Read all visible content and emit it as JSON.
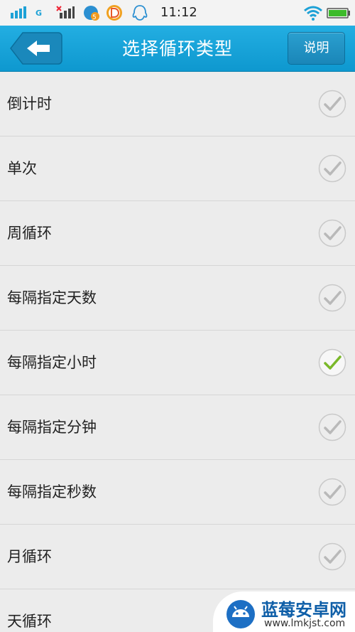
{
  "status_bar": {
    "time": "11:12",
    "network_label": "G",
    "notification_badge": "5",
    "icons": [
      "signal-icon",
      "network-g-icon",
      "signal-x-icon",
      "app-badge-icon",
      "d-app-icon",
      "qq-icon",
      "wifi-icon",
      "battery-icon"
    ]
  },
  "header": {
    "back_icon": "back-arrow-icon",
    "title": "选择循环类型",
    "help_label": "说明"
  },
  "options": [
    {
      "label": "倒计时",
      "selected": false
    },
    {
      "label": "单次",
      "selected": false
    },
    {
      "label": "周循环",
      "selected": false
    },
    {
      "label": "每隔指定天数",
      "selected": false
    },
    {
      "label": "每隔指定小时",
      "selected": true
    },
    {
      "label": "每隔指定分钟",
      "selected": false
    },
    {
      "label": "每隔指定秒数",
      "selected": false
    },
    {
      "label": "月循环",
      "selected": false
    },
    {
      "label": "天循环",
      "selected": false
    }
  ],
  "watermark": {
    "name": "蓝莓安卓网",
    "url": "www.lmkjst.com"
  },
  "colors": {
    "header": "#169fd6",
    "selected_check": "#7ab829",
    "unselected_check": "#b9b9b9",
    "background": "#ececec"
  }
}
